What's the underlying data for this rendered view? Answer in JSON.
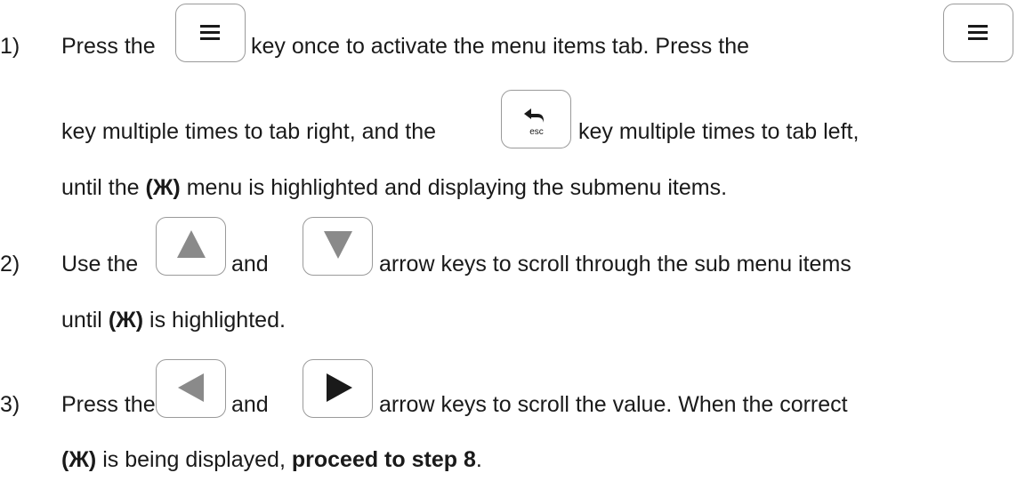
{
  "steps": [
    {
      "number": "1)",
      "line1": {
        "a": "Press the",
        "b": "key once to activate the menu items tab.  Press the"
      },
      "line2": {
        "a": "key multiple times to tab right, and the",
        "b": "key multiple times to tab left,"
      },
      "line3": {
        "a": "until the",
        "bold": "(Ж)",
        "b": "menu is highlighted and displaying the submenu items."
      }
    },
    {
      "number": "2)",
      "line1": {
        "a": "Use the",
        "b": "and",
        "c": "arrow keys to scroll through the sub menu items"
      },
      "line2": {
        "a": "until",
        "bold": "(Ж)",
        "b": "is highlighted."
      }
    },
    {
      "number": "3)",
      "line1": {
        "a": "Press the",
        "b": "and",
        "c": "arrow keys to scroll the value.  When the correct"
      },
      "line2": {
        "bold1": "(Ж)",
        "a": "is being displayed,",
        "bold2": "proceed to step 8",
        "b": "."
      }
    }
  ],
  "keys": {
    "menu": {
      "icon": "menu-icon"
    },
    "esc": {
      "icon": "back-arrow-icon",
      "label": "esc"
    },
    "up": {
      "icon": "up-triangle-icon"
    },
    "down": {
      "icon": "down-triangle-icon"
    },
    "left": {
      "icon": "left-triangle-icon"
    },
    "right": {
      "icon": "right-triangle-icon"
    }
  },
  "colors": {
    "text": "#1a1a1a",
    "key_border": "#9a9a9a",
    "arrow": "#8a8a8a"
  }
}
